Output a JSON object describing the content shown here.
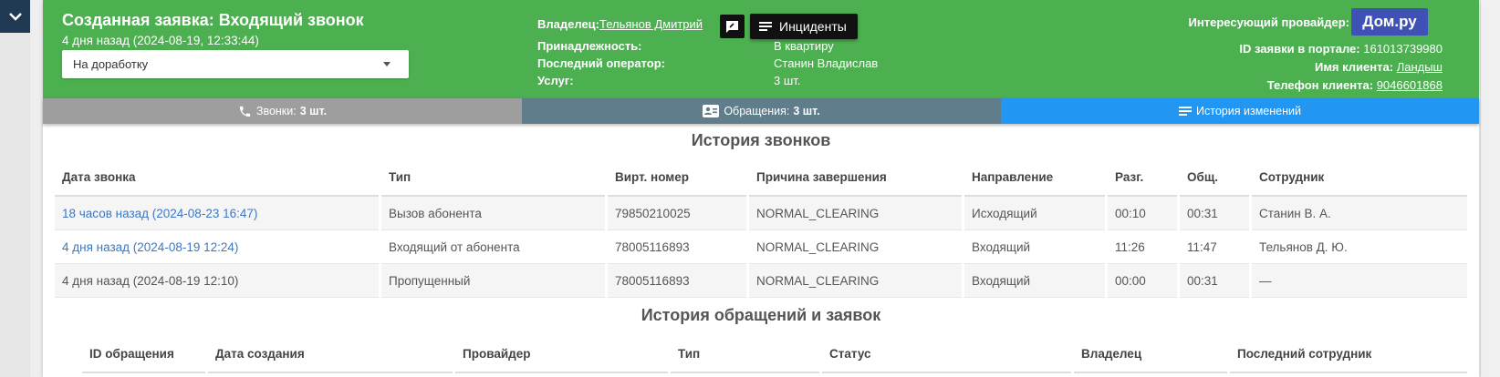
{
  "header": {
    "title": "Созданная заявка: Входящий звонок",
    "created": "4 дня назад (2024-08-19, 12:33:44)",
    "status_selected": "На доработку",
    "owner_label": "Владелец:",
    "owner_name": "Тельянов Дмитрий",
    "incidents_label": "Инциденты",
    "belonging_label": "Принадлежность:",
    "belonging_value": "В квартиру",
    "last_operator_label": "Последний оператор:",
    "last_operator_value": "Станин Владислав",
    "services_label": "Услуг:",
    "services_value": "3 шт.",
    "provider_label": "Интересующий провайдер:",
    "provider_name": "Дом.ру",
    "portal_id_label": "ID заявки в портале:",
    "portal_id_value": "161013739980",
    "client_name_label": "Имя клиента:",
    "client_name_value": "Ландыш",
    "client_phone_label": "Телефон клиента:",
    "client_phone_value": "9046601868"
  },
  "tabs": [
    {
      "label": "Звонки:",
      "count": "3 шт.",
      "icon": "phone-icon"
    },
    {
      "label": "Обращения:",
      "count": "3 шт.",
      "icon": "contact-card-icon"
    },
    {
      "label": "История изменений",
      "count": "",
      "icon": "list-icon"
    }
  ],
  "calls": {
    "title": "История звонков",
    "columns": [
      "Дата звонка",
      "Тип",
      "Вирт. номер",
      "Причина завершения",
      "Направление",
      "Разг.",
      "Общ.",
      "Сотрудник"
    ],
    "rows": [
      {
        "date": "18 часов назад (2024-08-23 16:47)",
        "type": "Вызов абонента",
        "virt": "79850210025",
        "reason": "NORMAL_CLEARING",
        "direction": "Исходящий",
        "talk": "00:10",
        "total": "00:31",
        "employee": "Станин В. А."
      },
      {
        "date": "4 дня назад (2024-08-19 12:24)",
        "type": "Входящий от абонента",
        "virt": "78005116893",
        "reason": "NORMAL_CLEARING",
        "direction": "Входящий",
        "talk": "11:26",
        "total": "11:47",
        "employee": "Тельянов Д. Ю."
      },
      {
        "date": "4 дня назад (2024-08-19 12:10)",
        "type": "Пропущенный",
        "virt": "78005116893",
        "reason": "NORMAL_CLEARING",
        "direction": "Входящий",
        "talk": "00:00",
        "total": "00:31",
        "employee": "—"
      }
    ]
  },
  "requests": {
    "title": "История обращений и заявок",
    "columns": [
      "ID обращения",
      "Дата создания",
      "Провайдер",
      "Тип",
      "Статус",
      "Владелец",
      "Последний сотрудник"
    ]
  },
  "colors": {
    "header": "#4caf50",
    "provider_badge": "#3f51b5",
    "tab_calls": "#9e9e9e",
    "tab_requests": "#607d8b",
    "tab_history": "#2196f3",
    "link": "#3b77c7"
  }
}
